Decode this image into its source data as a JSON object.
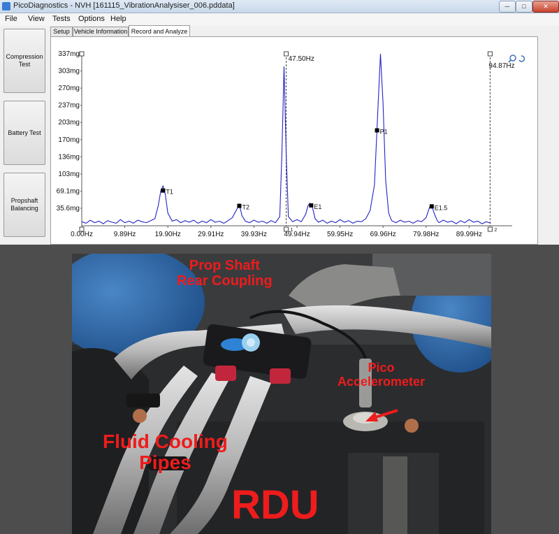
{
  "window": {
    "title": "PicoDiagnostics - NVH [161115_VibrationAnalysiser_006.pddata]",
    "min_glyph": "─",
    "max_glyph": "□",
    "close_glyph": "✕"
  },
  "menu": [
    "File",
    "View",
    "Tests",
    "Options",
    "Help"
  ],
  "sidebar": {
    "buttons": [
      {
        "label": "Compression Test"
      },
      {
        "label": "Battery Test"
      },
      {
        "label": "Propshaft Balancing"
      }
    ]
  },
  "tabs": [
    {
      "label": "Setup",
      "active": false
    },
    {
      "label": "Vehicle Information",
      "active": false
    },
    {
      "label": "Record and Analyze",
      "active": true
    }
  ],
  "chart_data": {
    "type": "line",
    "x_unit": "Hz",
    "xlim": [
      0,
      100
    ],
    "ylim": [
      0,
      337
    ],
    "y_ticks": [
      "337mg",
      "303mg",
      "270mg",
      "237mg",
      "203mg",
      "170mg",
      "136mg",
      "103mg",
      "69.1mg",
      "35.6mg"
    ],
    "x_ticks": [
      "0.00Hz",
      "9.89Hz",
      "19.90Hz",
      "29.91Hz",
      "39.93Hz",
      "49.94Hz",
      "59.95Hz",
      "69.96Hz",
      "79.98Hz",
      "89.99Hz"
    ],
    "line_color": "#2323c8",
    "cursors": [
      {
        "id": "1",
        "x": 47.5,
        "label": "47.50Hz"
      },
      {
        "id": "2",
        "x": 94.87,
        "label": "94.87Hz"
      }
    ],
    "markers": [
      {
        "label": "T1",
        "x": 18.9,
        "y": 69
      },
      {
        "label": "T2",
        "x": 36.6,
        "y": 39
      },
      {
        "label": "E1",
        "x": 53.3,
        "y": 40
      },
      {
        "label": "P1",
        "x": 68.6,
        "y": 187
      },
      {
        "label": "E1.5",
        "x": 81.3,
        "y": 38
      }
    ],
    "peaks": [
      {
        "x": 18.9,
        "y": 78
      },
      {
        "x": 36.6,
        "y": 42
      },
      {
        "x": 47.0,
        "y": 312
      },
      {
        "x": 53.0,
        "y": 44
      },
      {
        "x": 69.4,
        "y": 337
      },
      {
        "x": 81.3,
        "y": 40
      }
    ],
    "series": [
      {
        "values": [
          [
            0,
            8
          ],
          [
            1,
            5
          ],
          [
            2,
            11
          ],
          [
            3,
            6
          ],
          [
            4,
            9
          ],
          [
            5,
            4
          ],
          [
            6,
            10
          ],
          [
            7,
            7
          ],
          [
            8,
            5
          ],
          [
            9,
            12
          ],
          [
            10,
            6
          ],
          [
            11,
            9
          ],
          [
            12,
            5
          ],
          [
            13,
            11
          ],
          [
            14,
            8
          ],
          [
            15,
            6
          ],
          [
            16,
            10
          ],
          [
            17,
            14
          ],
          [
            17.8,
            40
          ],
          [
            18.4,
            70
          ],
          [
            18.9,
            78
          ],
          [
            19.4,
            62
          ],
          [
            20,
            25
          ],
          [
            21,
            9
          ],
          [
            22,
            12
          ],
          [
            23,
            6
          ],
          [
            24,
            10
          ],
          [
            25,
            7
          ],
          [
            26,
            11
          ],
          [
            27,
            5
          ],
          [
            28,
            9
          ],
          [
            29,
            6
          ],
          [
            30,
            12
          ],
          [
            31,
            7
          ],
          [
            32,
            9
          ],
          [
            33,
            5
          ],
          [
            34,
            10
          ],
          [
            35,
            16
          ],
          [
            36,
            32
          ],
          [
            36.6,
            42
          ],
          [
            37.2,
            20
          ],
          [
            38,
            9
          ],
          [
            39,
            6
          ],
          [
            40,
            11
          ],
          [
            41,
            7
          ],
          [
            42,
            9
          ],
          [
            43,
            5
          ],
          [
            44,
            10
          ],
          [
            45,
            6
          ],
          [
            46,
            18
          ],
          [
            46.5,
            140
          ],
          [
            47,
            312
          ],
          [
            47.5,
            140
          ],
          [
            48,
            18
          ],
          [
            49,
            8
          ],
          [
            50,
            12
          ],
          [
            51,
            8
          ],
          [
            52,
            22
          ],
          [
            52.6,
            40
          ],
          [
            53.0,
            44
          ],
          [
            53.6,
            36
          ],
          [
            54.2,
            14
          ],
          [
            55,
            7
          ],
          [
            56,
            11
          ],
          [
            57,
            5
          ],
          [
            58,
            9
          ],
          [
            59,
            6
          ],
          [
            60,
            12
          ],
          [
            61,
            7
          ],
          [
            62,
            10
          ],
          [
            63,
            5
          ],
          [
            64,
            9
          ],
          [
            65,
            8
          ],
          [
            66,
            14
          ],
          [
            67,
            30
          ],
          [
            68,
            80
          ],
          [
            68.7,
            210
          ],
          [
            69.4,
            337
          ],
          [
            70,
            240
          ],
          [
            70.6,
            90
          ],
          [
            71.3,
            25
          ],
          [
            72,
            10
          ],
          [
            73,
            6
          ],
          [
            74,
            11
          ],
          [
            75,
            7
          ],
          [
            76,
            9
          ],
          [
            77,
            5
          ],
          [
            78,
            10
          ],
          [
            79,
            8
          ],
          [
            80,
            16
          ],
          [
            80.8,
            36
          ],
          [
            81.3,
            40
          ],
          [
            81.9,
            24
          ],
          [
            82.6,
            10
          ],
          [
            83,
            6
          ],
          [
            84,
            11
          ],
          [
            85,
            7
          ],
          [
            86,
            9
          ],
          [
            87,
            4
          ],
          [
            88,
            10
          ],
          [
            89,
            6
          ],
          [
            90,
            12
          ],
          [
            91,
            7
          ],
          [
            92,
            9
          ],
          [
            93,
            4
          ],
          [
            94,
            8
          ],
          [
            95,
            5
          ]
        ]
      }
    ]
  },
  "photo": {
    "labels": {
      "prop_shaft": [
        "Prop Shaft",
        "Rear Coupling"
      ],
      "pico": [
        "Pico",
        "Accelerometer"
      ],
      "fluid": [
        "Fluid Cooling",
        "Pipes"
      ],
      "rdu": "RDU"
    },
    "label_color": "#ee1c1c"
  }
}
